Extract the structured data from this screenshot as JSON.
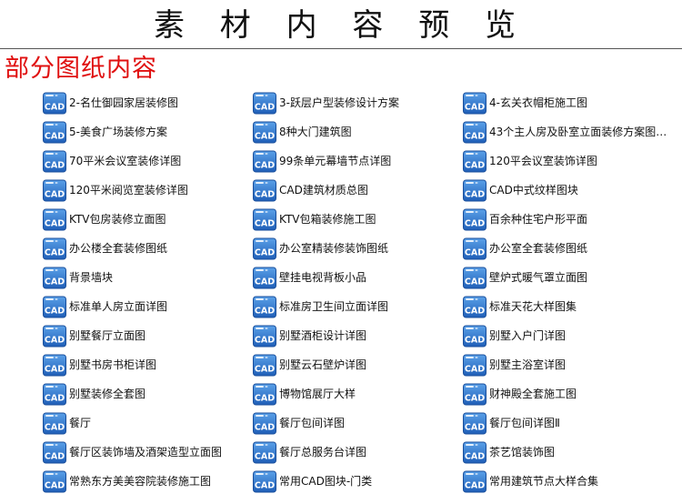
{
  "header": {
    "title": "素 材 内 容 预 览"
  },
  "section": {
    "title": "部分图纸内容"
  },
  "icon": {
    "label": "CAD",
    "name": "cad-file-icon",
    "color_top": "#5aa0e8",
    "color_bottom": "#1f5fb8"
  },
  "files": [
    {
      "label": "2-名仕御园家居装修图"
    },
    {
      "label": "3-跃层户型装修设计方案"
    },
    {
      "label": "4-玄关衣帽柜施工图"
    },
    {
      "label": "5-美食广场装修方案"
    },
    {
      "label": "8种大门建筑图"
    },
    {
      "label": "43个主人房及卧室立面装修方案图…"
    },
    {
      "label": "70平米会议室装修详图"
    },
    {
      "label": "99条单元幕墙节点详图"
    },
    {
      "label": "120平会议室装饰详图"
    },
    {
      "label": "120平米阅览室装修详图"
    },
    {
      "label": "CAD建筑材质总图"
    },
    {
      "label": "CAD中式纹样图块"
    },
    {
      "label": "KTV包房装修立面图"
    },
    {
      "label": "KTV包箱装修施工图"
    },
    {
      "label": "百余种住宅户形平面"
    },
    {
      "label": "办公楼全套装修图纸"
    },
    {
      "label": "办公室精装修装饰图纸"
    },
    {
      "label": "办公室全套装修图纸"
    },
    {
      "label": "背景墙块"
    },
    {
      "label": "壁挂电视背板小品"
    },
    {
      "label": "壁炉式暖气罩立面图"
    },
    {
      "label": "标准单人房立面详图"
    },
    {
      "label": "标准房卫生间立面详图"
    },
    {
      "label": "标准天花大样图集"
    },
    {
      "label": "别墅餐厅立面图"
    },
    {
      "label": "别墅酒柜设计详图"
    },
    {
      "label": "别墅入户门详图"
    },
    {
      "label": "别墅书房书柜详图"
    },
    {
      "label": "别墅云石壁炉详图"
    },
    {
      "label": "别墅主浴室详图"
    },
    {
      "label": "别墅装修全套图"
    },
    {
      "label": "博物馆展厅大样"
    },
    {
      "label": "财神殿全套施工图"
    },
    {
      "label": "餐厅"
    },
    {
      "label": "餐厅包间详图"
    },
    {
      "label": "餐厅包间详图Ⅱ"
    },
    {
      "label": "餐厅区装饰墙及酒架造型立面图"
    },
    {
      "label": "餐厅总服务台详图"
    },
    {
      "label": "茶艺馆装饰图"
    },
    {
      "label": "常熟东方美美容院装修施工图"
    },
    {
      "label": "常用CAD图块-门类"
    },
    {
      "label": "常用建筑节点大样合集"
    }
  ]
}
